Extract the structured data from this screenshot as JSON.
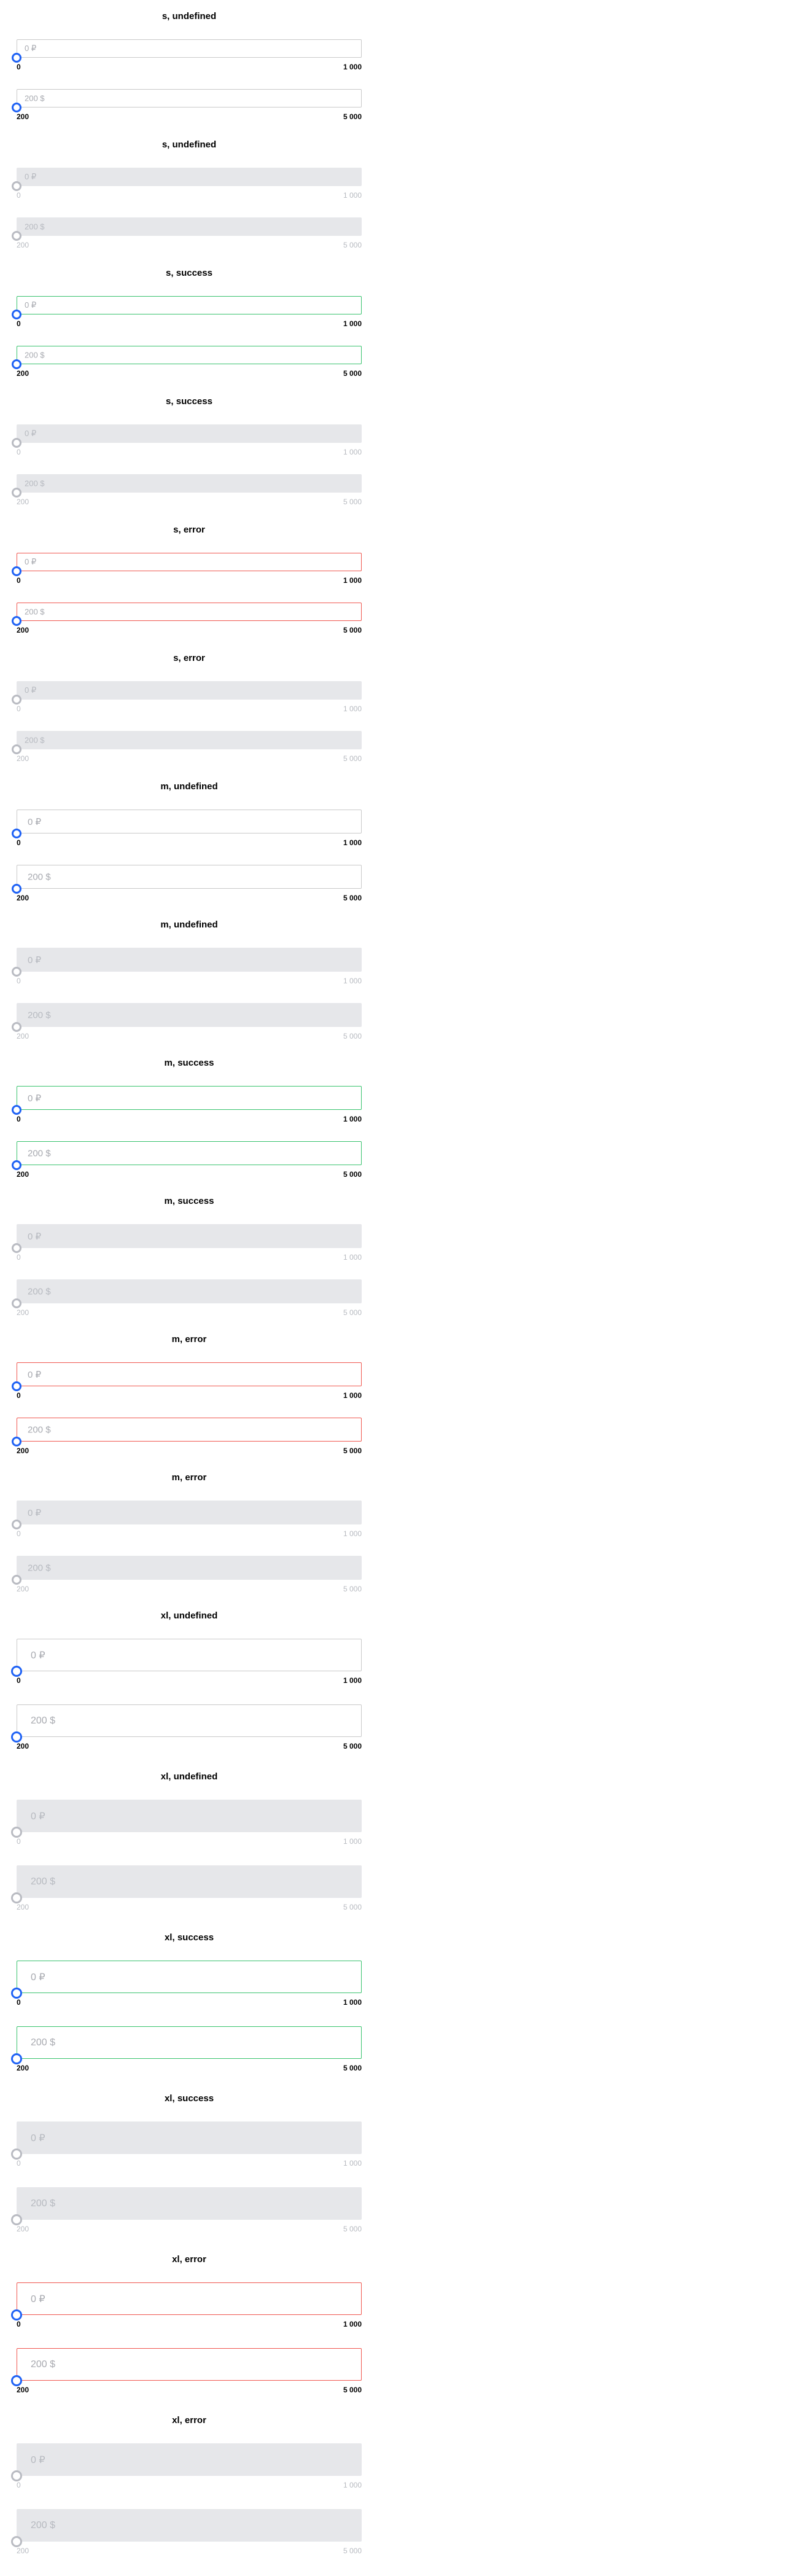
{
  "sections": [
    {
      "title": "s, undefined",
      "size": "s",
      "status": "undefined",
      "disabled": false
    },
    {
      "title": "s, undefined",
      "size": "s",
      "status": "undefined",
      "disabled": true
    },
    {
      "title": "s, success",
      "size": "s",
      "status": "success",
      "disabled": false
    },
    {
      "title": "s, success",
      "size": "s",
      "status": "success",
      "disabled": true
    },
    {
      "title": "s, error",
      "size": "s",
      "status": "error",
      "disabled": false
    },
    {
      "title": "s, error",
      "size": "s",
      "status": "error",
      "disabled": true
    },
    {
      "title": "m, undefined",
      "size": "m",
      "status": "undefined",
      "disabled": false
    },
    {
      "title": "m, undefined",
      "size": "m",
      "status": "undefined",
      "disabled": true
    },
    {
      "title": "m, success",
      "size": "m",
      "status": "success",
      "disabled": false
    },
    {
      "title": "m, success",
      "size": "m",
      "status": "success",
      "disabled": true
    },
    {
      "title": "m, error",
      "size": "m",
      "status": "error",
      "disabled": false
    },
    {
      "title": "m, error",
      "size": "m",
      "status": "error",
      "disabled": true
    },
    {
      "title": "xl, undefined",
      "size": "xl",
      "status": "undefined",
      "disabled": false
    },
    {
      "title": "xl, undefined",
      "size": "xl",
      "status": "undefined",
      "disabled": true
    },
    {
      "title": "xl, success",
      "size": "xl",
      "status": "success",
      "disabled": false
    },
    {
      "title": "xl, success",
      "size": "xl",
      "status": "success",
      "disabled": true
    },
    {
      "title": "xl, error",
      "size": "xl",
      "status": "error",
      "disabled": false
    },
    {
      "title": "xl, error",
      "size": "xl",
      "status": "error",
      "disabled": true
    }
  ],
  "inputs": [
    {
      "placeholder": "0 ₽",
      "min_label": "0",
      "max_label": "1 000",
      "value_fraction": 0
    },
    {
      "placeholder": "200 $",
      "min_label": "200",
      "max_label": "5 000",
      "value_fraction": 0
    }
  ],
  "colors": {
    "accent": "#1f62f5",
    "success": "#39c36e",
    "error": "#f0574f",
    "border": "#c9c9c9",
    "disabled_bg": "#e6e7ea",
    "disabled_text": "#b7bac0"
  }
}
